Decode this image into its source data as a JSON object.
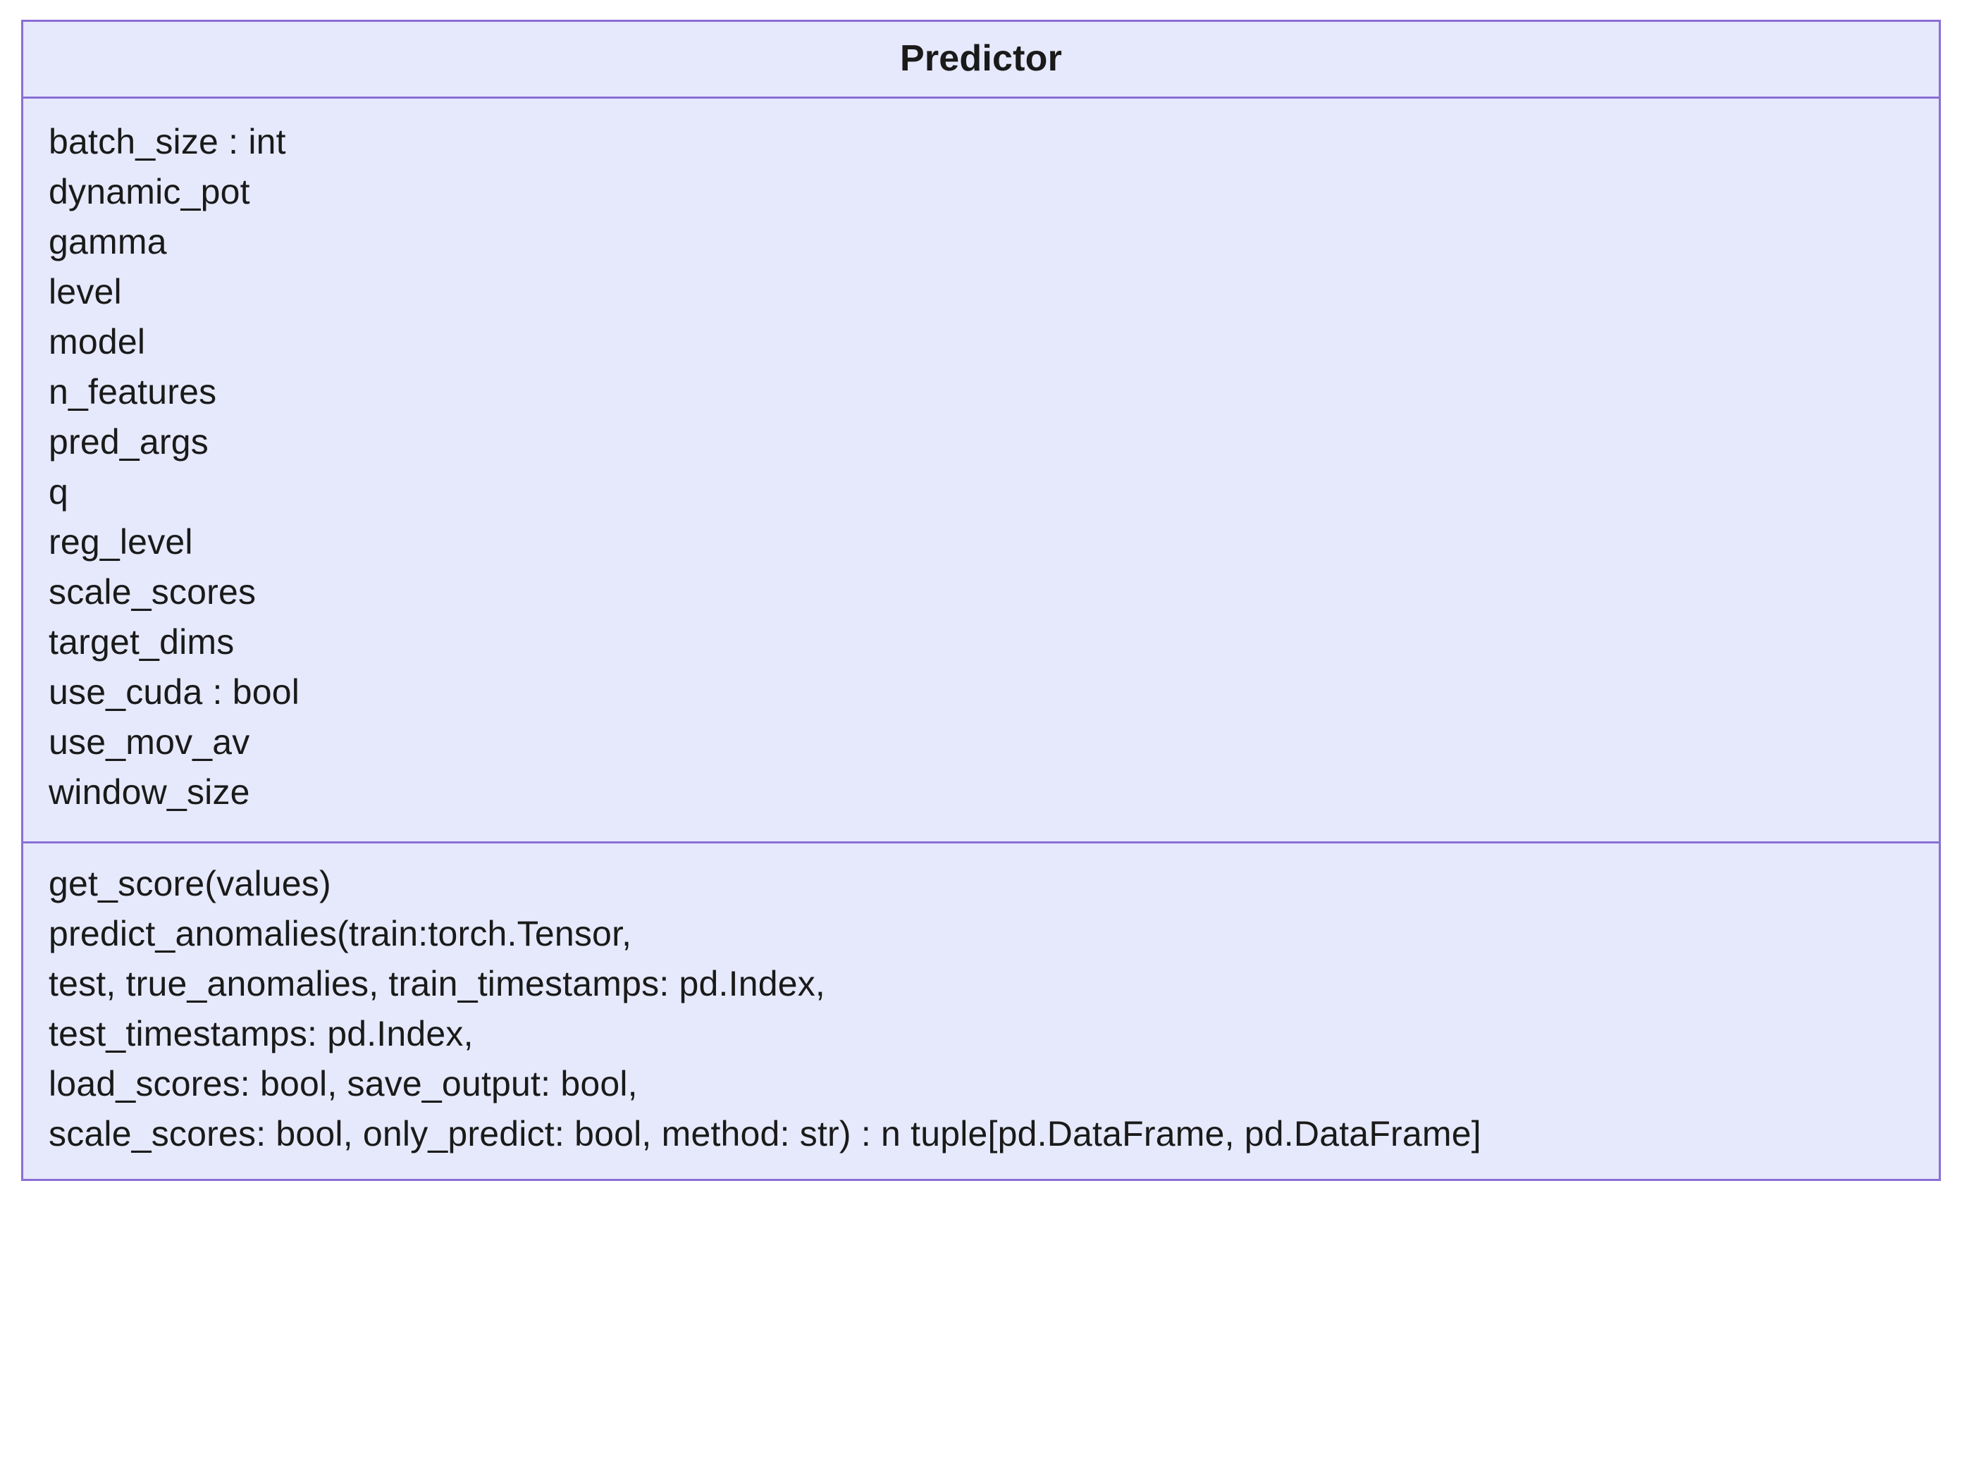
{
  "class": {
    "name": "Predictor",
    "attributes": [
      "batch_size : int",
      "dynamic_pot",
      "gamma",
      "level",
      "model",
      "n_features",
      "pred_args",
      "q",
      "reg_level",
      "scale_scores",
      "target_dims",
      "use_cuda : bool",
      "use_mov_av",
      "window_size"
    ],
    "methods": [
      "get_score(values)",
      "predict_anomalies(train:torch.Tensor,",
      "test, true_anomalies, train_timestamps: pd.Index,",
      "test_timestamps: pd.Index,",
      "load_scores: bool, save_output: bool,",
      "scale_scores: bool, only_predict: bool, method: str) : n tuple[pd.DataFrame, pd.DataFrame]"
    ]
  }
}
